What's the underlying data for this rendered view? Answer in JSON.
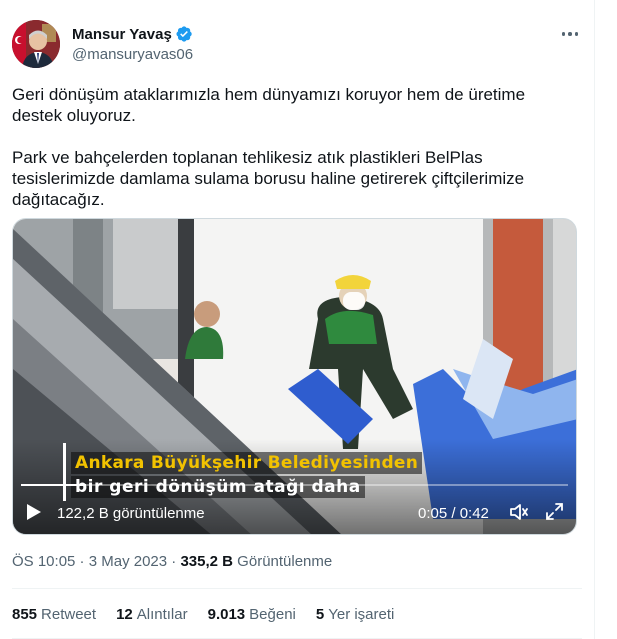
{
  "author": {
    "display_name": "Mansur Yavaş",
    "handle": "@mansuryavas06",
    "verified": true,
    "avatar_icon": "profile-photo-avatar"
  },
  "tweet": {
    "paragraphs": [
      "Geri dönüşüm ataklarımızla hem dünyamızı koruyor hem de üretime destek oluyoruz.",
      "Park ve bahçelerden toplanan tehlikesiz atık plastikleri BelPlas tesislerimizde damlama sulama borusu haline getirerek çiftçilerimize dağıtacağız."
    ]
  },
  "video": {
    "caption_line1": "Ankara Büyükşehir Belediyesinden",
    "caption_line2": "bir geri dönüşüm atağı daha",
    "views": "122,2 B görüntülenme",
    "time": "0:05 / 0:42",
    "progress": 0.119,
    "icons": [
      "play-icon",
      "volume-icon",
      "fullscreen-icon"
    ]
  },
  "meta": {
    "time": "ÖS 10:05",
    "separator": " · ",
    "date": "3 May 2023",
    "views_count": "335,2 B",
    "views_label": " Görüntülenme"
  },
  "stats": [
    {
      "count": "855",
      "label": "Retweet"
    },
    {
      "count": "12",
      "label": "Alıntılar"
    },
    {
      "count": "9.013",
      "label": "Beğeni"
    },
    {
      "count": "5",
      "label": "Yer işareti"
    }
  ],
  "colors": {
    "text": "#0f1419",
    "secondary": "#536471",
    "verified": "#1d9bf0",
    "caption_yellow": "#f2c200",
    "divider": "#eff3f4"
  }
}
